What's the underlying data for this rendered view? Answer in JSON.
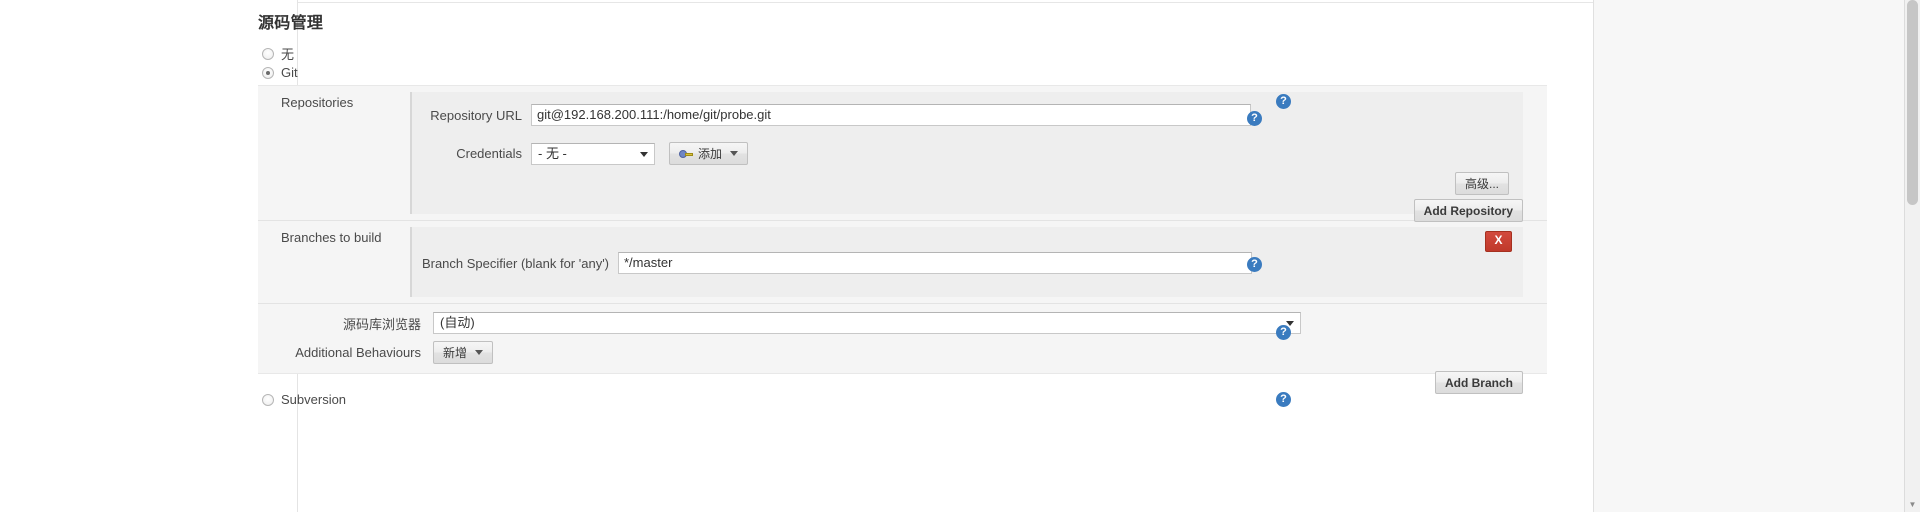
{
  "section": {
    "title": "源码管理"
  },
  "scm_options": [
    {
      "label": "无",
      "selected": false,
      "name": "scm-none"
    },
    {
      "label": "Git",
      "selected": true,
      "name": "scm-git"
    },
    {
      "label": "Subversion",
      "selected": false,
      "name": "scm-subversion"
    }
  ],
  "git": {
    "repositories": {
      "label": "Repositories",
      "repository_url": {
        "label": "Repository URL",
        "value": "git@192.168.200.111:/home/git/probe.git",
        "placeholder": ""
      },
      "credentials": {
        "label": "Credentials",
        "value": "- 无 -",
        "add_button": "添加"
      },
      "advanced_button": "高级...",
      "add_repository_button": "Add Repository"
    },
    "branches": {
      "label": "Branches to build",
      "delete_button": "X",
      "branch_specifier": {
        "label": "Branch Specifier (blank for 'any')",
        "value": "*/master",
        "placeholder": ""
      },
      "add_branch_button": "Add Branch"
    },
    "repository_browser": {
      "label": "源码库浏览器",
      "value": "(自动)"
    },
    "additional_behaviours": {
      "label": "Additional Behaviours",
      "add_button": "新增"
    }
  },
  "help_icon": "?",
  "colors": {
    "accent_help": "#3a7bbf",
    "delete_red": "#c0392b",
    "panel_bg": "#f5f5f5",
    "nested_bg": "#eeeeee"
  },
  "scrollbar": {
    "up_arrow": "▲",
    "down_arrow": "▼"
  }
}
